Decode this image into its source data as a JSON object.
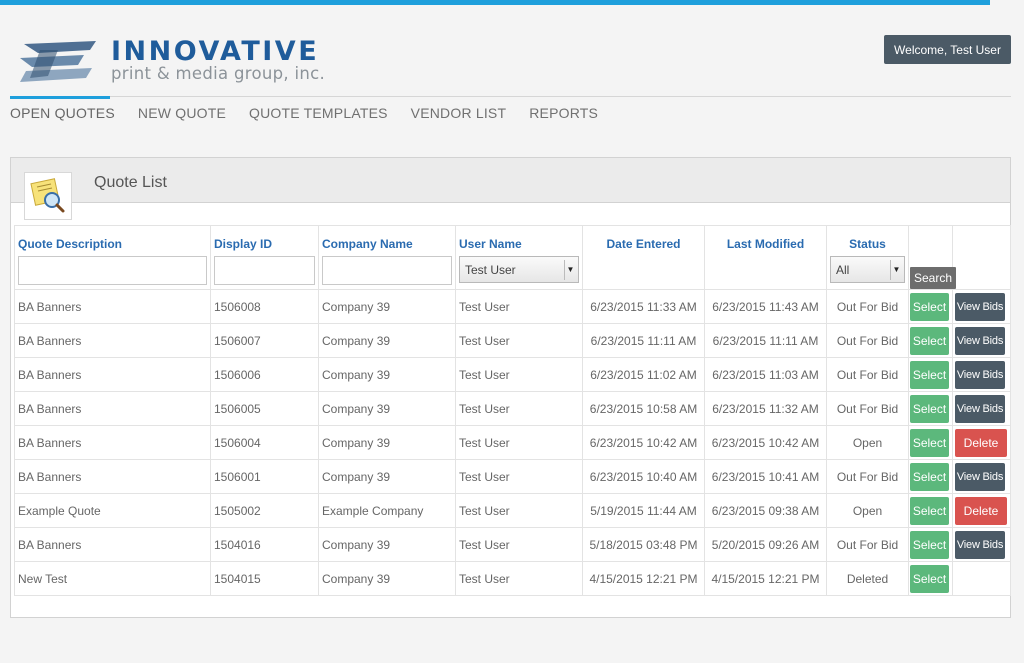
{
  "colors": {
    "accent": "#1e9fdc",
    "brand": "#1f5c9b",
    "select": "#5cb87c",
    "delete": "#d9534f",
    "dark": "#4b5a66"
  },
  "brand": {
    "name": "INNOVATIVE",
    "tagline": "print & media group, inc."
  },
  "user": {
    "welcome": "Welcome, Test User"
  },
  "nav": [
    "OPEN QUOTES",
    "NEW QUOTE",
    "QUOTE TEMPLATES",
    "VENDOR LIST",
    "REPORTS"
  ],
  "panel": {
    "title": "Quote List",
    "icon": "quote-search-icon"
  },
  "table": {
    "headers": [
      "Quote Description",
      "Display ID",
      "Company Name",
      "User Name",
      "Date Entered",
      "Last Modified",
      "Status"
    ],
    "filters": {
      "user_name": "Test User",
      "status": "All",
      "search_label": "Search"
    },
    "rows": [
      {
        "description": "BA Banners",
        "id": "1506008",
        "company": "Company 39",
        "user": "Test User",
        "entered": "6/23/2015 11:33 AM",
        "modified": "6/23/2015 11:43 AM",
        "status": "Out For Bid",
        "action": "View Bids"
      },
      {
        "description": "BA Banners",
        "id": "1506007",
        "company": "Company 39",
        "user": "Test User",
        "entered": "6/23/2015 11:11 AM",
        "modified": "6/23/2015 11:11 AM",
        "status": "Out For Bid",
        "action": "View Bids"
      },
      {
        "description": "BA Banners",
        "id": "1506006",
        "company": "Company 39",
        "user": "Test User",
        "entered": "6/23/2015 11:02 AM",
        "modified": "6/23/2015 11:03 AM",
        "status": "Out For Bid",
        "action": "View Bids"
      },
      {
        "description": "BA Banners",
        "id": "1506005",
        "company": "Company 39",
        "user": "Test User",
        "entered": "6/23/2015 10:58 AM",
        "modified": "6/23/2015 11:32 AM",
        "status": "Out For Bid",
        "action": "View Bids"
      },
      {
        "description": "BA Banners",
        "id": "1506004",
        "company": "Company 39",
        "user": "Test User",
        "entered": "6/23/2015 10:42 AM",
        "modified": "6/23/2015 10:42 AM",
        "status": "Open",
        "action": "Delete"
      },
      {
        "description": "BA Banners",
        "id": "1506001",
        "company": "Company 39",
        "user": "Test User",
        "entered": "6/23/2015 10:40 AM",
        "modified": "6/23/2015 10:41 AM",
        "status": "Out For Bid",
        "action": "View Bids"
      },
      {
        "description": "Example Quote",
        "id": "1505002",
        "company": "Example Company",
        "user": "Test User",
        "entered": "5/19/2015 11:44 AM",
        "modified": "6/23/2015 09:38 AM",
        "status": "Open",
        "action": "Delete"
      },
      {
        "description": "BA Banners",
        "id": "1504016",
        "company": "Company 39",
        "user": "Test User",
        "entered": "5/18/2015 03:48 PM",
        "modified": "5/20/2015 09:26 AM",
        "status": "Out For Bid",
        "action": "View Bids"
      },
      {
        "description": "New Test",
        "id": "1504015",
        "company": "Company 39",
        "user": "Test User",
        "entered": "4/15/2015 12:21 PM",
        "modified": "4/15/2015 12:21 PM",
        "status": "Deleted",
        "action": ""
      }
    ],
    "select_label": "Select"
  }
}
